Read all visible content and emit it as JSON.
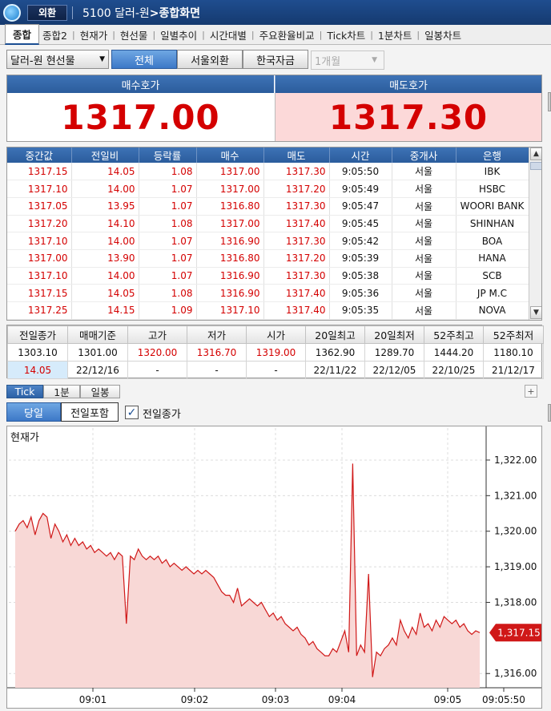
{
  "titlebar": {
    "badge": "외환",
    "code_title": "5100 달러-원",
    "screen_title": ">종합화면"
  },
  "tabs": [
    {
      "label": "종합",
      "active": true
    },
    {
      "label": "종합2"
    },
    {
      "label": "현재가"
    },
    {
      "label": "현선물"
    },
    {
      "label": "일별추이"
    },
    {
      "label": "시간대별"
    },
    {
      "label": "주요환율비교"
    },
    {
      "label": "Tick차트"
    },
    {
      "label": "1분차트"
    },
    {
      "label": "일봉차트"
    }
  ],
  "controls": {
    "instrument_select": "달러-원 현선물",
    "filter_all": "전체",
    "filter_seoul": "서울외환",
    "filter_korea": "한국자금",
    "period_select": "1개월"
  },
  "quote": {
    "bid_label": "매수호가",
    "bid_value": "1317.00",
    "ask_label": "매도호가",
    "ask_value": "1317.30",
    "colors": {
      "price": "#d40000",
      "ask_bg": "#fcd9d9",
      "header": "#2f63a6"
    }
  },
  "trades": {
    "headers": [
      "중간값",
      "전일비",
      "등락률",
      "매수",
      "매도",
      "시간",
      "중개사",
      "은행"
    ],
    "rows": [
      [
        "1317.15",
        "14.05",
        "1.08",
        "1317.00",
        "1317.30",
        "9:05:50",
        "서울",
        "IBK"
      ],
      [
        "1317.10",
        "14.00",
        "1.07",
        "1317.00",
        "1317.20",
        "9:05:49",
        "서울",
        "HSBC"
      ],
      [
        "1317.05",
        "13.95",
        "1.07",
        "1316.80",
        "1317.30",
        "9:05:47",
        "서울",
        "WOORI BANK"
      ],
      [
        "1317.20",
        "14.10",
        "1.08",
        "1317.00",
        "1317.40",
        "9:05:45",
        "서울",
        "SHINHAN"
      ],
      [
        "1317.10",
        "14.00",
        "1.07",
        "1316.90",
        "1317.30",
        "9:05:42",
        "서울",
        "BOA"
      ],
      [
        "1317.00",
        "13.90",
        "1.07",
        "1316.80",
        "1317.20",
        "9:05:39",
        "서울",
        "HANA"
      ],
      [
        "1317.10",
        "14.00",
        "1.07",
        "1316.90",
        "1317.30",
        "9:05:38",
        "서울",
        "SCB"
      ],
      [
        "1317.15",
        "14.05",
        "1.08",
        "1316.90",
        "1317.40",
        "9:05:36",
        "서울",
        "JP M.C"
      ],
      [
        "1317.25",
        "14.15",
        "1.09",
        "1317.10",
        "1317.40",
        "9:05:35",
        "서울",
        "NOVA"
      ]
    ]
  },
  "summary": {
    "headers": [
      "전일종가",
      "매매기준",
      "고가",
      "저가",
      "시가",
      "20일최고",
      "20일최저",
      "52주최고",
      "52주최저"
    ],
    "values": [
      "1303.10",
      "1301.00",
      "1320.00",
      "1316.70",
      "1319.00",
      "1362.90",
      "1289.70",
      "1444.20",
      "1180.10"
    ],
    "second_row": [
      "14.05",
      "22/12/16",
      "-",
      "-",
      "-",
      "22/11/22",
      "22/12/05",
      "22/10/25",
      "21/12/17"
    ]
  },
  "chart_tabs": [
    "Tick",
    "1분",
    "일봉"
  ],
  "chart_options": {
    "day_button": "당일",
    "include_prev_button": "전일포함",
    "prev_close_checkbox": "전일종가",
    "prev_close_checked": true
  },
  "chart_data": {
    "type": "area",
    "title": "현재가",
    "x_tick_labels": [
      "09:01",
      "09:02",
      "09:03",
      "09:04",
      "09:05",
      "09:05:50"
    ],
    "y_tick_labels": [
      "1,322.00",
      "1,321.00",
      "1,320.00",
      "1,319.00",
      "1,318.00",
      "1,316.00"
    ],
    "ylim": [
      1315.6,
      1322.9
    ],
    "current_label": "1,317.15",
    "colors": {
      "line": "#d01818",
      "fill": "#f8d8d6",
      "grid": "#dcdcdc",
      "label_bg": "#d01818"
    },
    "series": [
      {
        "values": [
          1320.0,
          1320.2,
          1320.3,
          1320.1,
          1320.4,
          1319.9,
          1320.3,
          1320.5,
          1320.4,
          1319.8,
          1320.2,
          1320.0,
          1319.7,
          1319.9,
          1319.6,
          1319.8,
          1319.6,
          1319.7,
          1319.5,
          1319.6,
          1319.4,
          1319.5,
          1319.4,
          1319.3,
          1319.4,
          1319.2,
          1319.4,
          1319.3,
          1317.4,
          1319.3,
          1319.2,
          1319.5,
          1319.3,
          1319.2,
          1319.3,
          1319.2,
          1319.3,
          1319.1,
          1319.2,
          1319.0,
          1319.1,
          1319.0,
          1318.9,
          1319.0,
          1318.9,
          1318.8,
          1318.9,
          1318.8,
          1318.9,
          1318.8,
          1318.7,
          1318.5,
          1318.3,
          1318.2,
          1318.2,
          1318.0,
          1318.4,
          1317.9,
          1318.0,
          1318.1,
          1318.0,
          1317.9,
          1318.0,
          1317.8,
          1317.6,
          1317.7,
          1317.5,
          1317.6,
          1317.4,
          1317.3,
          1317.2,
          1317.3,
          1317.1,
          1317.0,
          1316.8,
          1316.9,
          1316.7,
          1316.6,
          1316.5,
          1316.5,
          1316.7,
          1316.6,
          1316.9,
          1317.2,
          1316.6,
          1321.9,
          1316.5,
          1316.8,
          1316.6,
          1318.8,
          1315.9,
          1316.6,
          1316.5,
          1316.7,
          1316.8,
          1317.0,
          1316.8,
          1317.5,
          1317.2,
          1317.0,
          1317.3,
          1317.1,
          1317.7,
          1317.3,
          1317.4,
          1317.2,
          1317.5,
          1317.3,
          1317.6,
          1317.5,
          1317.4,
          1317.5,
          1317.3,
          1317.4,
          1317.2,
          1317.1,
          1317.2,
          1317.15
        ]
      }
    ]
  }
}
